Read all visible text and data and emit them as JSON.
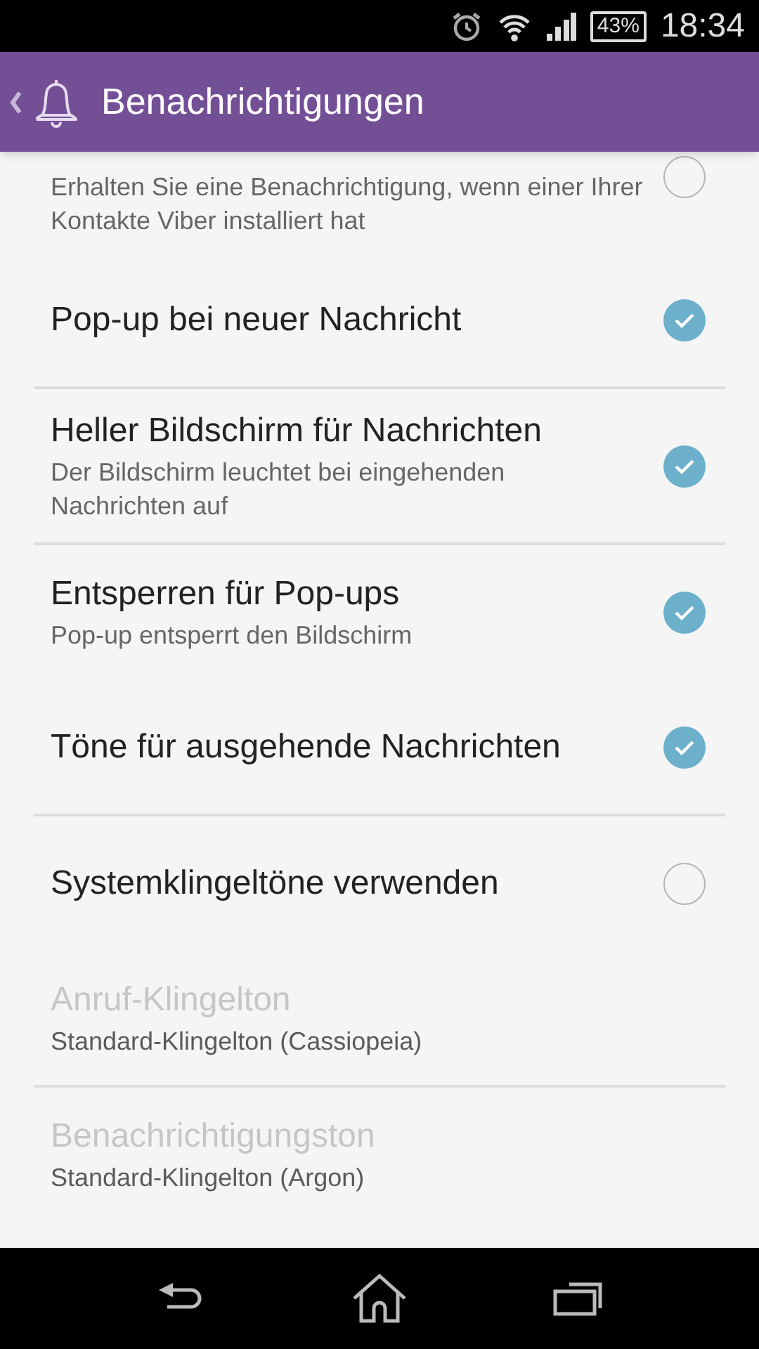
{
  "status_bar": {
    "battery": "43%",
    "time": "18:34"
  },
  "header": {
    "title": "Benachrichtigungen"
  },
  "settings": [
    {
      "kind": "partial",
      "summary": "Erhalten Sie eine Benachrichtigung, wenn einer Ihrer Kontakte Viber installiert hat",
      "checked": false,
      "divider": false
    },
    {
      "kind": "checkbox",
      "title": "Pop-up bei neuer Nachricht",
      "checked": true,
      "divider": true
    },
    {
      "kind": "checkbox",
      "title": "Heller Bildschirm für Nachrichten",
      "summary": "Der Bildschirm leuchtet bei eingehenden Nachrichten auf",
      "checked": true,
      "divider": true
    },
    {
      "kind": "checkbox",
      "title": "Entsperren für Pop-ups",
      "summary": "Pop-up entsperrt den Bildschirm",
      "checked": true,
      "divider": false
    },
    {
      "kind": "checkbox",
      "title": "Töne für ausgehende Nachrichten",
      "checked": true,
      "divider": true
    },
    {
      "kind": "checkbox",
      "title": "Systemklingeltöne verwenden",
      "checked": false,
      "divider": false
    },
    {
      "kind": "text",
      "title": "Anruf-Klingelton",
      "summary": "Standard-Klingelton (Cassiopeia)",
      "disabled": true,
      "divider": true
    },
    {
      "kind": "text",
      "title": "Benachrichtigungston",
      "summary": "Standard-Klingelton (Argon)",
      "disabled": true,
      "divider": false
    }
  ]
}
